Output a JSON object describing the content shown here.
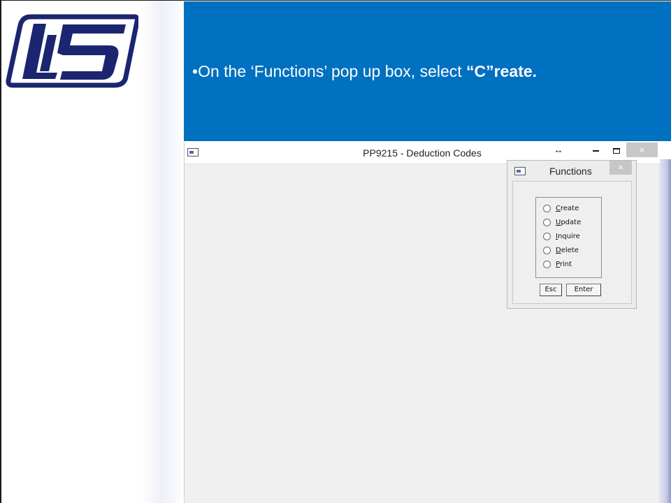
{
  "banner": {
    "bullet": "•",
    "text_prefix": "On the ‘Functions’ pop up box, select ",
    "text_bold": "“C”reate."
  },
  "app": {
    "title": "PP9215 - Deduction Codes",
    "resize_glyph": "↔",
    "close_glyph": "×"
  },
  "functions_dialog": {
    "title": "Functions",
    "close_glyph": "×",
    "options": [
      {
        "mnemonic": "C",
        "rest": "reate"
      },
      {
        "mnemonic": "U",
        "rest": "pdate"
      },
      {
        "mnemonic": "I",
        "rest": "nquire"
      },
      {
        "mnemonic": "D",
        "rest": "elete"
      },
      {
        "mnemonic": "P",
        "rest": "rint"
      }
    ],
    "esc_label": "Esc",
    "enter_label": "Enter"
  },
  "colors": {
    "banner": "#0070c0",
    "logo_navy": "#1b2570"
  }
}
